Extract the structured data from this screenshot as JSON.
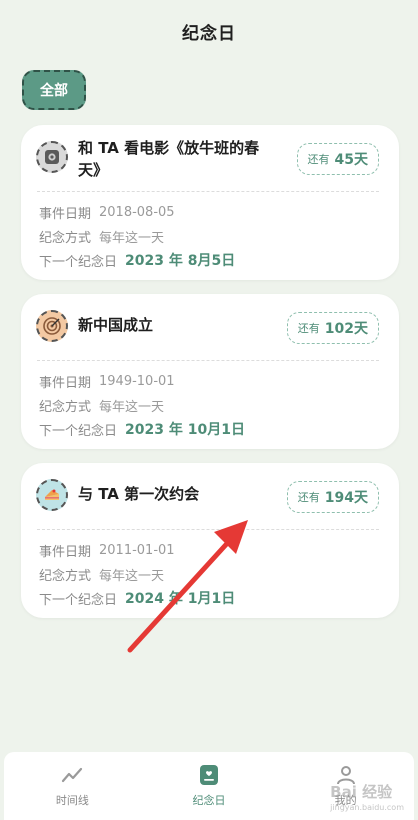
{
  "header": {
    "title": "纪念日"
  },
  "filter": {
    "chip_label": "全部"
  },
  "cards": [
    {
      "title": "和 TA 看电影《放牛班的春天》",
      "badge_prefix": "还有",
      "badge_days": "45天",
      "event_date_label": "事件日期",
      "event_date": "2018-08-05",
      "mode_label": "纪念方式",
      "mode": "每年这一天",
      "next_label": "下一个纪念日",
      "next_date": "2023 年 8月5日",
      "icon": "camera-icon"
    },
    {
      "title": "新中国成立",
      "badge_prefix": "还有",
      "badge_days": "102天",
      "event_date_label": "事件日期",
      "event_date": "1949-10-01",
      "mode_label": "纪念方式",
      "mode": "每年这一天",
      "next_label": "下一个纪念日",
      "next_date": "2023 年 10月1日",
      "icon": "target-icon"
    },
    {
      "title": "与 TA 第一次约会",
      "badge_prefix": "还有",
      "badge_days": "194天",
      "event_date_label": "事件日期",
      "event_date": "2011-01-01",
      "mode_label": "纪念方式",
      "mode": "每年这一天",
      "next_label": "下一个纪念日",
      "next_date": "2024 年 1月1日",
      "icon": "cake-icon"
    }
  ],
  "tabbar": {
    "items": [
      {
        "label": "时间线",
        "icon": "chart-line-icon"
      },
      {
        "label": "纪念日",
        "icon": "anniversary-icon"
      },
      {
        "label": "我的",
        "icon": "user-icon"
      }
    ]
  },
  "watermark": {
    "text": "Bai 经验",
    "sub": "jingyan.baidu.com"
  },
  "colors": {
    "background": "#eef3ec",
    "accent": "#5c9a86",
    "accent_text": "#4e8c77",
    "arrow": "#e53935"
  }
}
